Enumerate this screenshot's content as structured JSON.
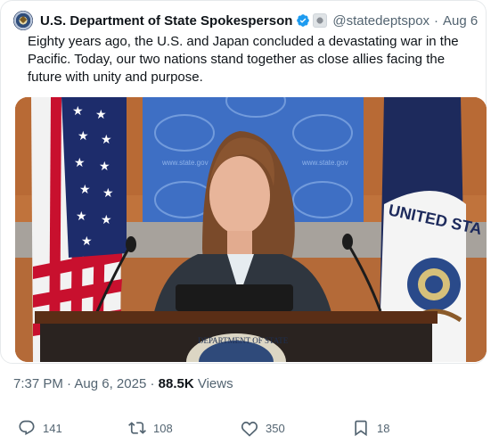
{
  "author": {
    "name": "U.S. Department of State Spokesperson",
    "handle": "@statedeptspox",
    "separator": "·",
    "date": "Aug 6"
  },
  "tweet": {
    "text": "Eighty years ago, the U.S. and Japan concluded a devastating war in the Pacific. Today, our two nations stand together as close allies facing the future with unity and purpose."
  },
  "media": {
    "backdrop_text": "www.state.gov",
    "flag_text": "UNITED STA",
    "podium_seal_text": "DEPARTMENT OF STATE"
  },
  "meta": {
    "time": "7:37 PM",
    "sep1": " · ",
    "date": "Aug 6, 2025",
    "sep2": " · ",
    "views_count": "88.5K",
    "views_label": " Views"
  },
  "actions": {
    "replies": "141",
    "reposts": "108",
    "likes": "350",
    "bookmarks": "18"
  },
  "colors": {
    "verified_blue": "#1d9bf0",
    "text_secondary": "#536471",
    "backdrop_blue": "#3e6fc4"
  }
}
